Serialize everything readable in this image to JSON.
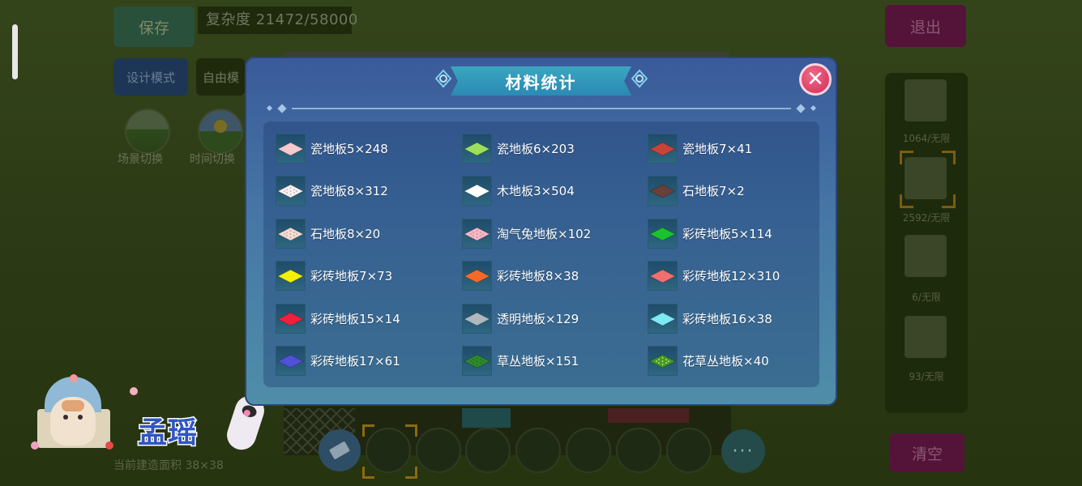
{
  "background": {
    "save_label": "保存",
    "complexity_label": "复杂度 21472/58000",
    "exit_label": "退出",
    "design_mode_label": "设计模式",
    "free_mode_label": "自由模",
    "scene_switch_label": "场景切换",
    "time_switch_label": "时间切换",
    "area_label": "当前建造面积 38×38",
    "clear_label": "清空",
    "watermark_text": "孟瑶",
    "right_panel": {
      "counts": [
        "1064/无限",
        "2592/无限",
        "6/无限",
        "93/无限"
      ]
    },
    "toolbar": {
      "more_label": "···"
    }
  },
  "modal": {
    "title": "材料统计",
    "close_label": "✕",
    "materials": [
      {
        "label": "瓷地板5×248",
        "color": "#f6c9cc",
        "pattern": "plain"
      },
      {
        "label": "瓷地板6×203",
        "color": "#9be05a",
        "pattern": "plain"
      },
      {
        "label": "瓷地板7×41",
        "color": "#c8433a",
        "pattern": "plain"
      },
      {
        "label": "瓷地板8×312",
        "color": "#f8f0f0",
        "pattern": "dots"
      },
      {
        "label": "木地板3×504",
        "color": "#ffffff",
        "pattern": "plain"
      },
      {
        "label": "石地板7×2",
        "color": "#6a3f38",
        "pattern": "dots"
      },
      {
        "label": "石地板8×20",
        "color": "#f2ddd2",
        "pattern": "dots"
      },
      {
        "label": "淘气兔地板×102",
        "color": "#f7b8c6",
        "pattern": "dots"
      },
      {
        "label": "彩砖地板5×114",
        "color": "#19c22e",
        "pattern": "plain"
      },
      {
        "label": "彩砖地板7×73",
        "color": "#f4f000",
        "pattern": "plain"
      },
      {
        "label": "彩砖地板8×38",
        "color": "#f46a2a",
        "pattern": "plain"
      },
      {
        "label": "彩砖地板12×310",
        "color": "#f0706f",
        "pattern": "plain"
      },
      {
        "label": "彩砖地板15×14",
        "color": "#f0203a",
        "pattern": "plain"
      },
      {
        "label": "透明地板×129",
        "color": "#aeb8c0",
        "pattern": "plain"
      },
      {
        "label": "彩砖地板16×38",
        "color": "#7de9f0",
        "pattern": "plain"
      },
      {
        "label": "彩砖地板17×61",
        "color": "#5050d8",
        "pattern": "plain"
      },
      {
        "label": "草丛地板×151",
        "color": "#2e8a2a",
        "pattern": "grass"
      },
      {
        "label": "花草丛地板×40",
        "color": "#3f9a2a",
        "pattern": "flowers"
      }
    ]
  }
}
